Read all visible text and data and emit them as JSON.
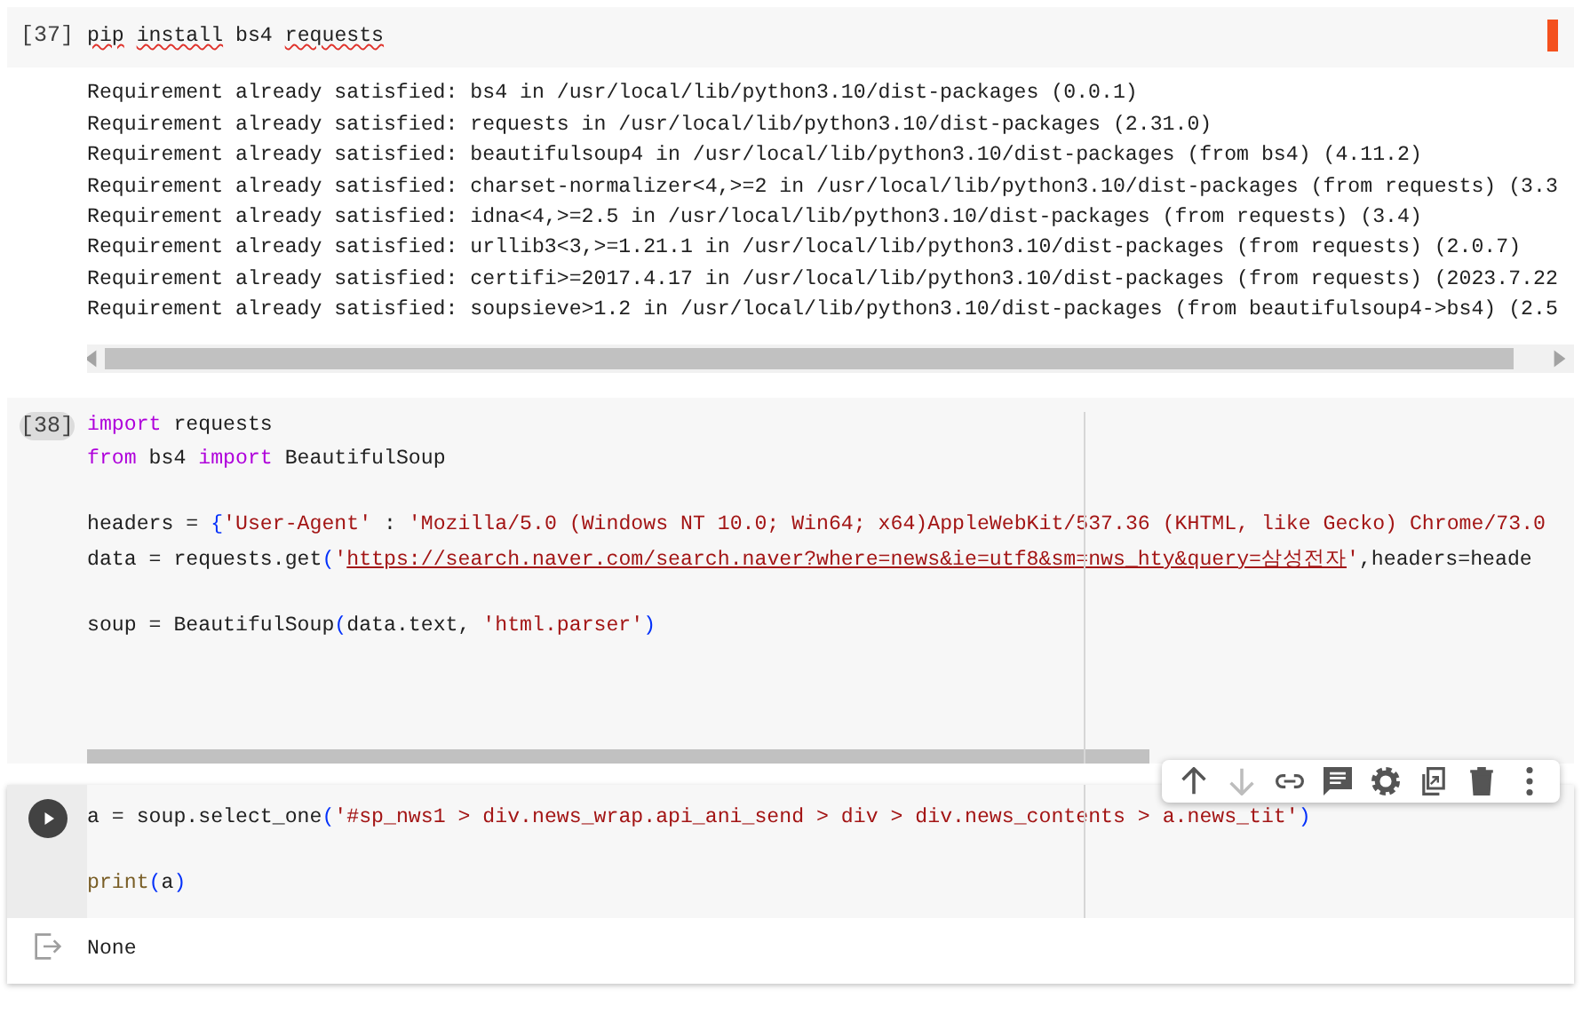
{
  "cells": [
    {
      "prompt": "[37]",
      "focused": false,
      "prompt_highlighted": false,
      "running_marker": true,
      "h_scrollbar": false,
      "lines": [
        {
          "gap_before": false,
          "tokens": [
            {
              "kind": "misspelled",
              "t": "pip",
              "color": "#212121"
            },
            {
              "kind": "misspelled",
              "t": " install",
              "color": "#212121"
            },
            {
              "kind": "text",
              "t": " bs4",
              "color": "#212121"
            },
            {
              "kind": "misspelled",
              "t": " requests",
              "color": "#212121"
            }
          ]
        }
      ],
      "output": {
        "kind": "text",
        "scrollbar": true,
        "lines": [
          "Requirement already satisfied: bs4 in /usr/local/lib/python3.10/dist-packages (0.0.1)",
          "Requirement already satisfied: requests in /usr/local/lib/python3.10/dist-packages (2.31.0)",
          "Requirement already satisfied: beautifulsoup4 in /usr/local/lib/python3.10/dist-packages (from bs4) (4.11.2)",
          "Requirement already satisfied: charset-normalizer<4,>=2 in /usr/local/lib/python3.10/dist-packages (from requests) (3.3",
          "Requirement already satisfied: idna<4,>=2.5 in /usr/local/lib/python3.10/dist-packages (from requests) (3.4)",
          "Requirement already satisfied: urllib3<3,>=1.21.1 in /usr/local/lib/python3.10/dist-packages (from requests) (2.0.7)",
          "Requirement already satisfied: certifi>=2017.4.17 in /usr/local/lib/python3.10/dist-packages (from requests) (2023.7.22",
          "Requirement already satisfied: soupsieve>1.2 in /usr/local/lib/python3.10/dist-packages (from beautifulsoup4->bs4) (2.5"
        ]
      }
    },
    {
      "prompt": "[38]",
      "focused": false,
      "prompt_highlighted": true,
      "running_marker": false,
      "h_scrollbar": true,
      "lines": [
        {
          "gap_before": false,
          "tokens": [
            {
              "kind": "text",
              "t": "import",
              "color": "#af00db"
            },
            {
              "kind": "text",
              "t": " requests",
              "color": "#212121"
            }
          ]
        },
        {
          "gap_before": false,
          "tokens": [
            {
              "kind": "text",
              "t": "from",
              "color": "#af00db"
            },
            {
              "kind": "text",
              "t": " bs4 ",
              "color": "#212121"
            },
            {
              "kind": "text",
              "t": "import",
              "color": "#af00db"
            },
            {
              "kind": "text",
              "t": " BeautifulSoup",
              "color": "#212121"
            }
          ]
        },
        {
          "gap_before": true,
          "tokens": [
            {
              "kind": "text",
              "t": "headers = ",
              "color": "#212121"
            },
            {
              "kind": "text",
              "t": "{",
              "color": "#0431fa"
            },
            {
              "kind": "text",
              "t": "'User-Agent'",
              "color": "#a31515"
            },
            {
              "kind": "text",
              "t": " : ",
              "color": "#212121"
            },
            {
              "kind": "text",
              "t": "'Mozilla/5.0 (Windows NT 10.0; Win64; x64)AppleWebKit/537.36 (KHTML, like Gecko) Chrome/73.0",
              "color": "#a31515"
            }
          ]
        },
        {
          "gap_before": false,
          "tokens": [
            {
              "kind": "text",
              "t": "data = requests.get",
              "color": "#212121"
            },
            {
              "kind": "text",
              "t": "(",
              "color": "#0431fa"
            },
            {
              "kind": "text",
              "t": "'",
              "color": "#a31515"
            },
            {
              "kind": "link",
              "t": "https://search.naver.com/search.naver?where=news&ie=utf8&sm=nws_hty&query=삼성전자",
              "color": "#a31515"
            },
            {
              "kind": "text",
              "t": "'",
              "color": "#a31515"
            },
            {
              "kind": "text",
              "t": ",headers=heade",
              "color": "#212121"
            }
          ]
        },
        {
          "gap_before": true,
          "tokens": [
            {
              "kind": "text",
              "t": "soup = BeautifulSoup",
              "color": "#212121"
            },
            {
              "kind": "text",
              "t": "(",
              "color": "#0431fa"
            },
            {
              "kind": "text",
              "t": "data.text, ",
              "color": "#212121"
            },
            {
              "kind": "text",
              "t": "'html.parser'",
              "color": "#a31515"
            },
            {
              "kind": "text",
              "t": ")",
              "color": "#0431fa"
            }
          ]
        }
      ]
    },
    {
      "focused": true,
      "running_marker": false,
      "h_scrollbar": false,
      "toolbar": [
        {
          "kind": "up",
          "disabled": false
        },
        {
          "kind": "down",
          "disabled": true
        },
        {
          "kind": "link",
          "disabled": false
        },
        {
          "kind": "comment",
          "disabled": false
        },
        {
          "kind": "settings",
          "disabled": false
        },
        {
          "kind": "mirror",
          "disabled": false
        },
        {
          "kind": "delete",
          "disabled": false
        },
        {
          "kind": "more",
          "disabled": false
        }
      ],
      "lines": [
        {
          "gap_before": false,
          "tokens": [
            {
              "kind": "text",
              "t": "a = soup.select_one",
              "color": "#212121"
            },
            {
              "kind": "text",
              "t": "(",
              "color": "#0431fa"
            },
            {
              "kind": "text",
              "t": "'#sp_nws1 > div.news_wrap.api_ani_send > div > div.news_contents > a.news_tit'",
              "color": "#a31515"
            },
            {
              "kind": "text",
              "t": ")",
              "color": "#0431fa"
            }
          ]
        },
        {
          "gap_before": true,
          "tokens": [
            {
              "kind": "text",
              "t": "print",
              "color": "#795e26"
            },
            {
              "kind": "text",
              "t": "(",
              "color": "#0431fa"
            },
            {
              "kind": "text",
              "t": "a",
              "color": "#212121"
            },
            {
              "kind": "text",
              "t": ")",
              "color": "#0431fa"
            }
          ]
        }
      ],
      "output": {
        "kind": "result",
        "scrollbar": false,
        "lines": [
          "None"
        ]
      }
    }
  ]
}
